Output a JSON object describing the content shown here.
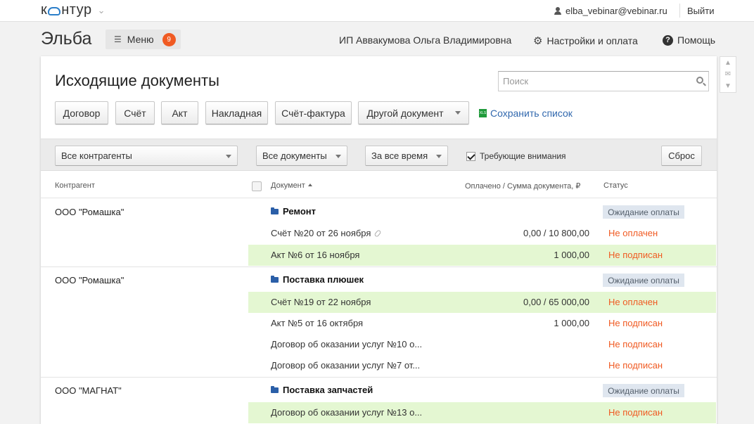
{
  "topbar": {
    "logo": {
      "pre": "к",
      "post": "нтур"
    },
    "user_email": "elba_vebinar@vebinar.ru",
    "logout": "Выйти"
  },
  "header": {
    "app_title": "Эльба",
    "menu_label": "Меню",
    "menu_badge": "9",
    "org_name": "ИП Аввакумова Ольга Владимировна",
    "settings": "Настройки и оплата",
    "help": "Помощь"
  },
  "page": {
    "title": "Исходящие документы",
    "search_placeholder": "Поиск",
    "buttons": {
      "contract": "Договор",
      "invoice": "Счёт",
      "act": "Акт",
      "waybill": "Накладная",
      "factura": "Счёт-фактура",
      "other": "Другой документ"
    },
    "save_list": "Сохранить список",
    "xls_label": "XLS"
  },
  "filters": {
    "contractors": "Все контрагенты",
    "documents": "Все документы",
    "period": "За все время",
    "attention_label": "Требующие внимания",
    "attention_checked": true,
    "reset": "Сброс"
  },
  "table": {
    "headers": {
      "contractor": "Контрагент",
      "document": "Документ",
      "paid": "Оплачено / Сумма документа, ₽",
      "status": "Статус"
    },
    "colors": {
      "highlight": "#e4f7d2",
      "status_red": "#f05a22",
      "badge_bg": "#dfe6ef"
    },
    "groups": [
      {
        "contractor": "ООО \"Ромашка\"",
        "title": "Ремонт",
        "badge": "Ожидание оплаты",
        "rows": [
          {
            "doc": "Счёт №20 от 26 ноября",
            "sum": "0,00 / 10 800,00",
            "status": "Не оплачен"
          },
          {
            "doc": "Акт №6 от 16 ноября",
            "sum": "1 000,00",
            "status": "Не подписан"
          }
        ]
      },
      {
        "contractor": "ООО \"Ромашка\"",
        "title": "Поставка плюшек",
        "badge": "Ожидание оплаты",
        "rows": [
          {
            "doc": "Счёт №19 от 22 ноября",
            "sum": "0,00 / 65 000,00",
            "status": "Не оплачен"
          },
          {
            "doc": "Акт №5 от 16 октября",
            "sum": "1 000,00",
            "status": "Не подписан"
          },
          {
            "doc": "Договор об оказании услуг №10 о...",
            "sum": "",
            "status": "Не подписан"
          },
          {
            "doc": "Договор об оказании услуг №7 от...",
            "sum": "",
            "status": "Не подписан"
          }
        ]
      },
      {
        "contractor": "ООО \"МАГНАТ\"",
        "title": "Поставка запчастей",
        "badge": "Ожидание оплаты",
        "rows": [
          {
            "doc": "Договор об оказании услуг №13 о...",
            "sum": "",
            "status": "Не подписан"
          }
        ]
      }
    ]
  }
}
